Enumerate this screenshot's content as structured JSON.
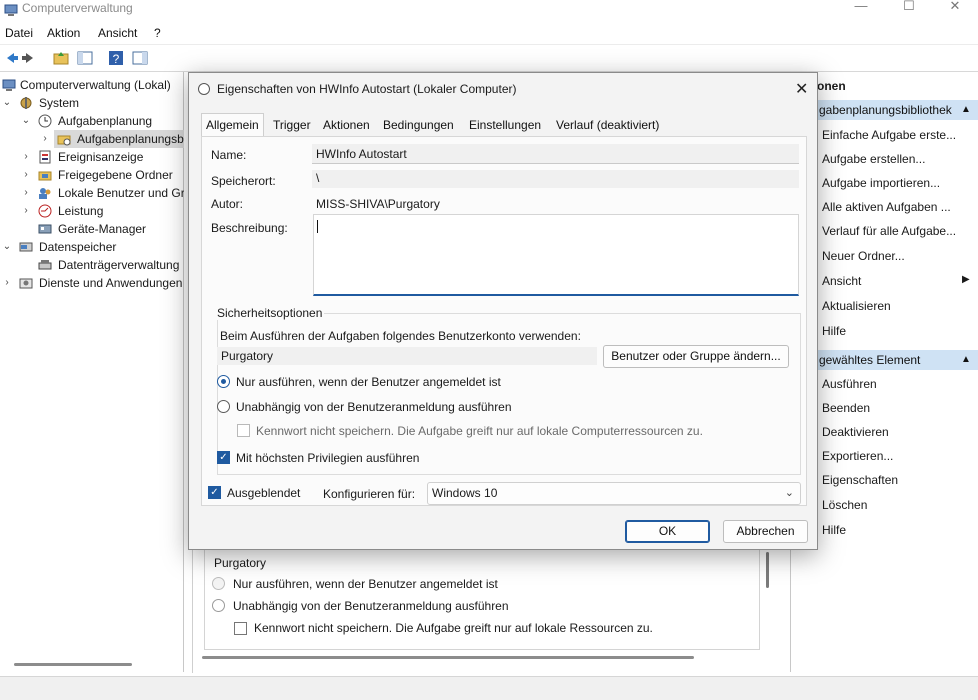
{
  "app": {
    "title": "Computerverwaltung"
  },
  "menu": [
    "Datei",
    "Aktion",
    "Ansicht",
    "?"
  ],
  "tree": {
    "items": [
      {
        "label": "Computerverwaltung (Lokal)"
      },
      {
        "label": "System"
      },
      {
        "label": "Aufgabenplanung"
      },
      {
        "label": "Aufgabenplanungsb"
      },
      {
        "label": "Ereignisanzeige"
      },
      {
        "label": "Freigegebene Ordner"
      },
      {
        "label": "Lokale Benutzer und Gr"
      },
      {
        "label": "Leistung"
      },
      {
        "label": "Geräte-Manager"
      },
      {
        "label": "Datenspeicher"
      },
      {
        "label": "Datenträgerverwaltung"
      },
      {
        "label": "Dienste und Anwendungen"
      }
    ]
  },
  "actions": {
    "pane_title": "onen",
    "section1": "gabenplanungsbibliothek",
    "items1": [
      "Einfache Aufgabe erste...",
      "Aufgabe erstellen...",
      "Aufgabe importieren...",
      "Alle aktiven Aufgaben ...",
      "Verlauf für alle Aufgabe...",
      "Neuer Ordner...",
      "Ansicht",
      "Aktualisieren",
      "Hilfe"
    ],
    "section2": "gewähltes Element",
    "items2": [
      "Ausführen",
      "Beenden",
      "Deaktivieren",
      "Exportieren...",
      "Eigenschaften",
      "Löschen",
      "Hilfe"
    ]
  },
  "background": {
    "account": "Purgatory",
    "radio1": "Nur ausführen, wenn der Benutzer angemeldet ist",
    "radio2": "Unabhängig von der Benutzeranmeldung ausführen",
    "check": "Kennwort nicht speichern. Die Aufgabe greift nur auf lokale Ressourcen zu."
  },
  "dialog": {
    "title": "Eigenschaften von HWInfo Autostart (Lokaler Computer)",
    "tabs": [
      "Allgemein",
      "Trigger",
      "Aktionen",
      "Bedingungen",
      "Einstellungen",
      "Verlauf (deaktiviert)"
    ],
    "name_label": "Name:",
    "name_value": "HWInfo Autostart",
    "location_label": "Speicherort:",
    "location_value": "\\",
    "author_label": "Autor:",
    "author_value": "MISS-SHIVA\\Purgatory",
    "description_label": "Beschreibung:",
    "description_value": "",
    "security": {
      "title": "Sicherheitsoptionen",
      "account_prompt": "Beim Ausführen der Aufgaben folgendes Benutzerkonto verwenden:",
      "account_value": "Purgatory",
      "change_button": "Benutzer oder Gruppe ändern...",
      "radio_logged_on": "Nur ausführen, wenn der Benutzer angemeldet ist",
      "radio_independent": "Unabhängig von der Benutzeranmeldung ausführen",
      "no_password": "Kennwort nicht speichern. Die Aufgabe greift nur auf lokale Computerressourcen zu.",
      "highest_privileges": "Mit höchsten Privilegien ausführen"
    },
    "hidden_label": "Ausgeblendet",
    "configure_label": "Konfigurieren für:",
    "configure_value": "Windows 10",
    "ok": "OK",
    "cancel": "Abbrechen"
  },
  "colors": {
    "accent": "#1f5aa0",
    "selection": "#cfe2f4"
  }
}
